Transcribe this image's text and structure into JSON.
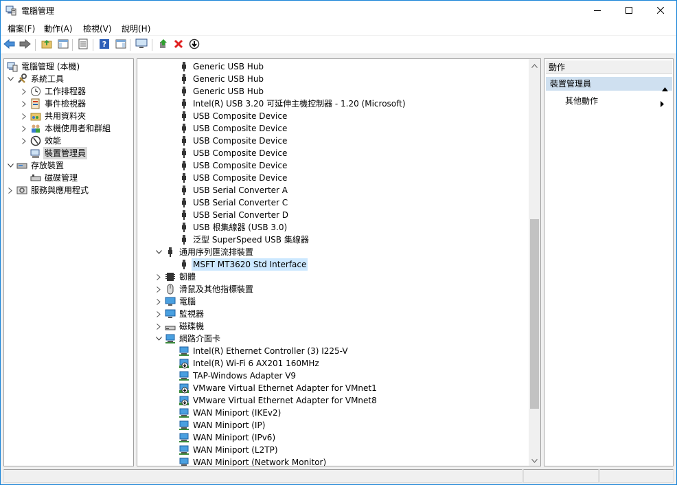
{
  "window": {
    "title": "電腦管理",
    "controls": [
      "minimize-icon",
      "maximize-icon",
      "close-icon"
    ]
  },
  "menu": [
    "檔案(F)",
    "動作(A)",
    "檢視(V)",
    "說明(H)"
  ],
  "toolbar": [
    "back-arrow-icon",
    "forward-arrow-icon",
    "up-folder-icon",
    "show-hide-tree-icon",
    "properties-icon",
    "help-icon",
    "action-pane-icon",
    "monitor-icon",
    "update-driver-icon",
    "uninstall-icon",
    "disable-device-icon"
  ],
  "tree": {
    "root": "電腦管理 (本機)",
    "items": [
      {
        "label": "系統工具"
      },
      {
        "label": "工作排程器"
      },
      {
        "label": "事件檢視器"
      },
      {
        "label": "共用資料夾"
      },
      {
        "label": "本機使用者和群組"
      },
      {
        "label": "效能"
      },
      {
        "label": "裝置管理員"
      },
      {
        "label": "存放裝置"
      },
      {
        "label": "磁碟管理"
      },
      {
        "label": "服務與應用程式"
      }
    ]
  },
  "devices": {
    "usb_children": [
      "Generic USB Hub",
      "Generic USB Hub",
      "Generic USB Hub",
      "Intel(R) USB 3.20 可延伸主機控制器 - 1.20 (Microsoft)",
      "USB Composite Device",
      "USB Composite Device",
      "USB Composite Device",
      "USB Composite Device",
      "USB Composite Device",
      "USB Composite Device",
      "USB Serial Converter A",
      "USB Serial Converter C",
      "USB Serial Converter D",
      "USB 根集線器 (USB 3.0)",
      "泛型 SuperSpeed USB 集線器"
    ],
    "serial_bus_label": "通用序列匯流排裝置",
    "serial_bus_child": "MSFT MT3620 Std Interface",
    "categories": [
      "韌體",
      "滑鼠及其他指標裝置",
      "電腦",
      "監視器",
      "磁碟機"
    ],
    "network_label": "網路介面卡",
    "network_children": [
      "Intel(R) Ethernet Controller (3) I225-V",
      "Intel(R) Wi-Fi 6 AX201 160MHz",
      "TAP-Windows Adapter V9",
      "VMware Virtual Ethernet Adapter for VMnet1",
      "VMware Virtual Ethernet Adapter for VMnet8",
      "WAN Miniport (IKEv2)",
      "WAN Miniport (IP)",
      "WAN Miniport (IPv6)",
      "WAN Miniport (L2TP)",
      "WAN Miniport (Network Monitor)"
    ]
  },
  "actions": {
    "header": "動作",
    "section": "裝置管理員",
    "item": "其他動作"
  },
  "colors": {
    "accent_border": "#1883d7",
    "selection_blue": "#cce8ff",
    "action_section": "#cfe0f0"
  }
}
